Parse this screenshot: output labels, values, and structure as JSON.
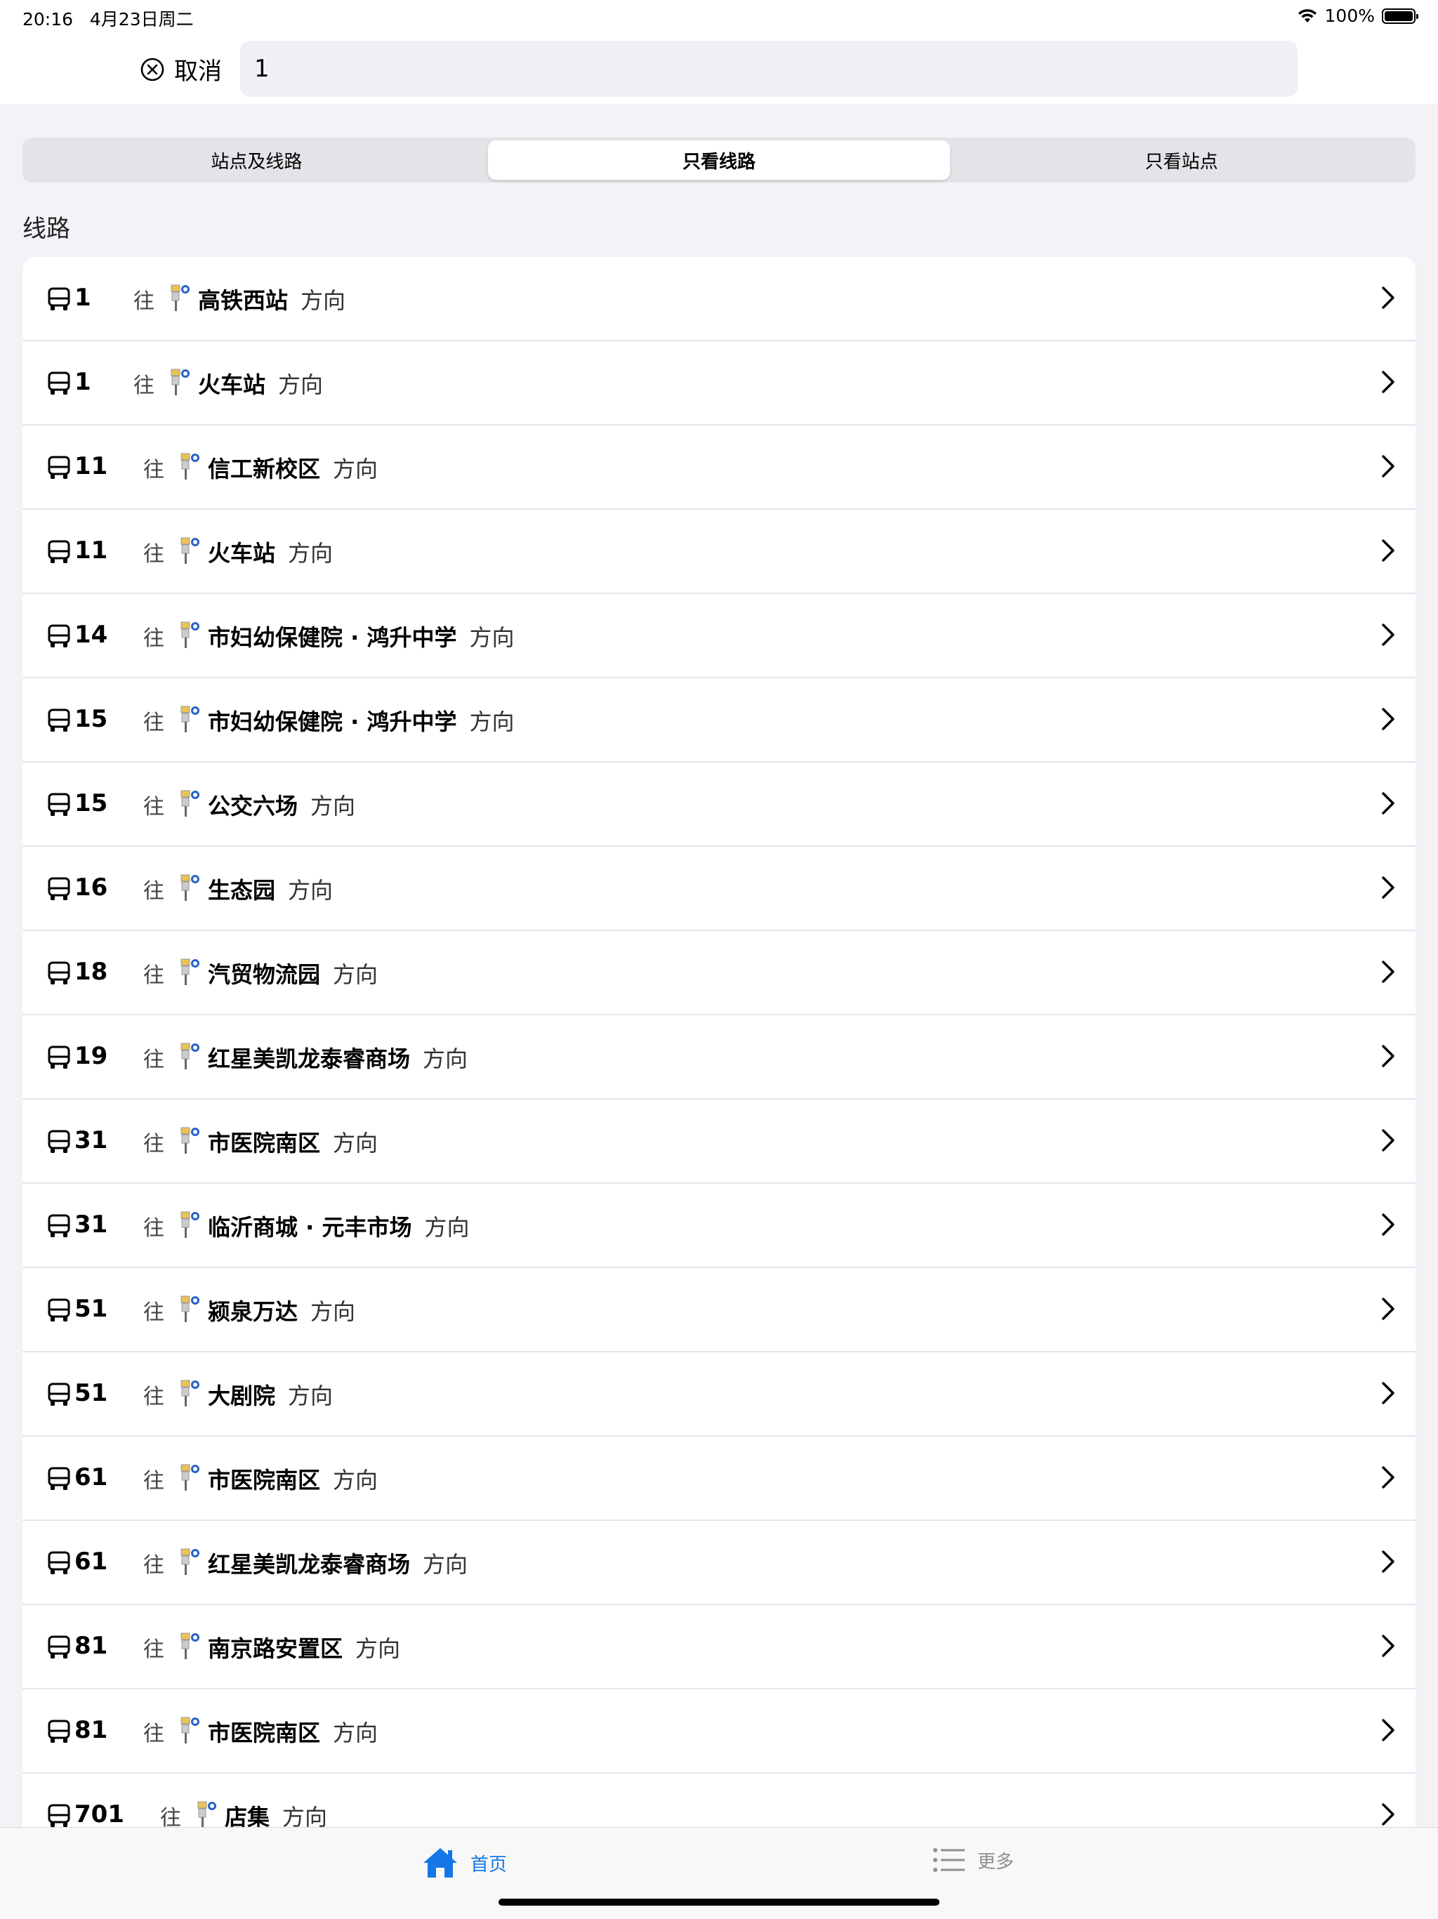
{
  "status": {
    "time": "20:16",
    "date": "4月23日周二",
    "battery": "100%",
    "battery_level": 1.0
  },
  "search": {
    "cancel_label": "取消",
    "value": "1"
  },
  "tabs": [
    {
      "label": "站点及线路",
      "active": false
    },
    {
      "label": "只看线路",
      "active": true
    },
    {
      "label": "只看站点",
      "active": false
    }
  ],
  "section_title": "线路",
  "to_label": "往",
  "direction_label": "方向",
  "routes": [
    {
      "number": "1",
      "destination": "高铁西站"
    },
    {
      "number": "1",
      "destination": "火车站"
    },
    {
      "number": "11",
      "destination": "信工新校区"
    },
    {
      "number": "11",
      "destination": "火车站"
    },
    {
      "number": "14",
      "destination": "市妇幼保健院 · 鸿升中学"
    },
    {
      "number": "15",
      "destination": "市妇幼保健院 · 鸿升中学"
    },
    {
      "number": "15",
      "destination": "公交六场"
    },
    {
      "number": "16",
      "destination": "生态园"
    },
    {
      "number": "18",
      "destination": "汽贸物流园"
    },
    {
      "number": "19",
      "destination": "红星美凯龙泰睿商场"
    },
    {
      "number": "31",
      "destination": "市医院南区"
    },
    {
      "number": "31",
      "destination": "临沂商城 · 元丰市场"
    },
    {
      "number": "51",
      "destination": "颍泉万达"
    },
    {
      "number": "51",
      "destination": "大剧院"
    },
    {
      "number": "61",
      "destination": "市医院南区"
    },
    {
      "number": "61",
      "destination": "红星美凯龙泰睿商场"
    },
    {
      "number": "81",
      "destination": "南京路安置区"
    },
    {
      "number": "81",
      "destination": "市医院南区"
    },
    {
      "number": "701",
      "destination": "店集"
    }
  ],
  "tab_bar": {
    "home_label": "首页",
    "more_label": "更多"
  },
  "colors": {
    "accent": "#1677e6",
    "inactive": "#8e8e93",
    "background": "#f2f2f7"
  }
}
